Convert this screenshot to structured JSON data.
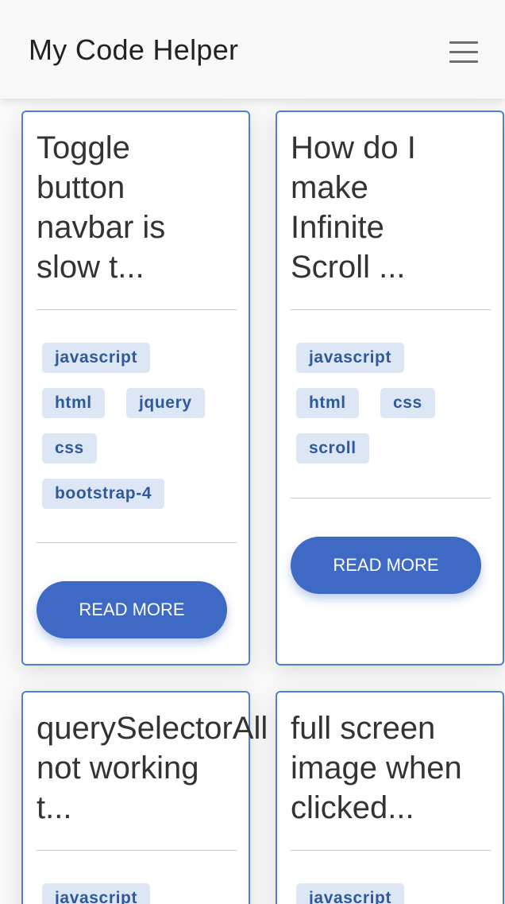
{
  "app": {
    "title": "My Code Helper",
    "menu_icon": "hamburger-menu-icon"
  },
  "cards": [
    {
      "title_lines": [
        "Toggle",
        "button",
        "navbar is",
        "slow t..."
      ],
      "tags": [
        "javascript",
        "html",
        "jquery",
        "css",
        "bootstrap-4"
      ],
      "button_label": "READ MORE"
    },
    {
      "title_lines": [
        "How do I",
        "make",
        "Infinite",
        "Scroll ..."
      ],
      "tags": [
        "javascript",
        "html",
        "css",
        "scroll"
      ],
      "button_label": "READ MORE"
    },
    {
      "title_lines": [
        "querySelectorAll",
        "not working",
        "t..."
      ],
      "tags": [
        "javascript"
      ]
    },
    {
      "title_lines": [
        "full screen",
        "image when",
        "clicked..."
      ],
      "tags": [
        "javascript"
      ]
    }
  ],
  "colors": {
    "accent": "#3e6ac6",
    "card_border": "#4f7fcf",
    "tag_background": "#dde6f5",
    "tag_text": "#2e5a9c"
  }
}
